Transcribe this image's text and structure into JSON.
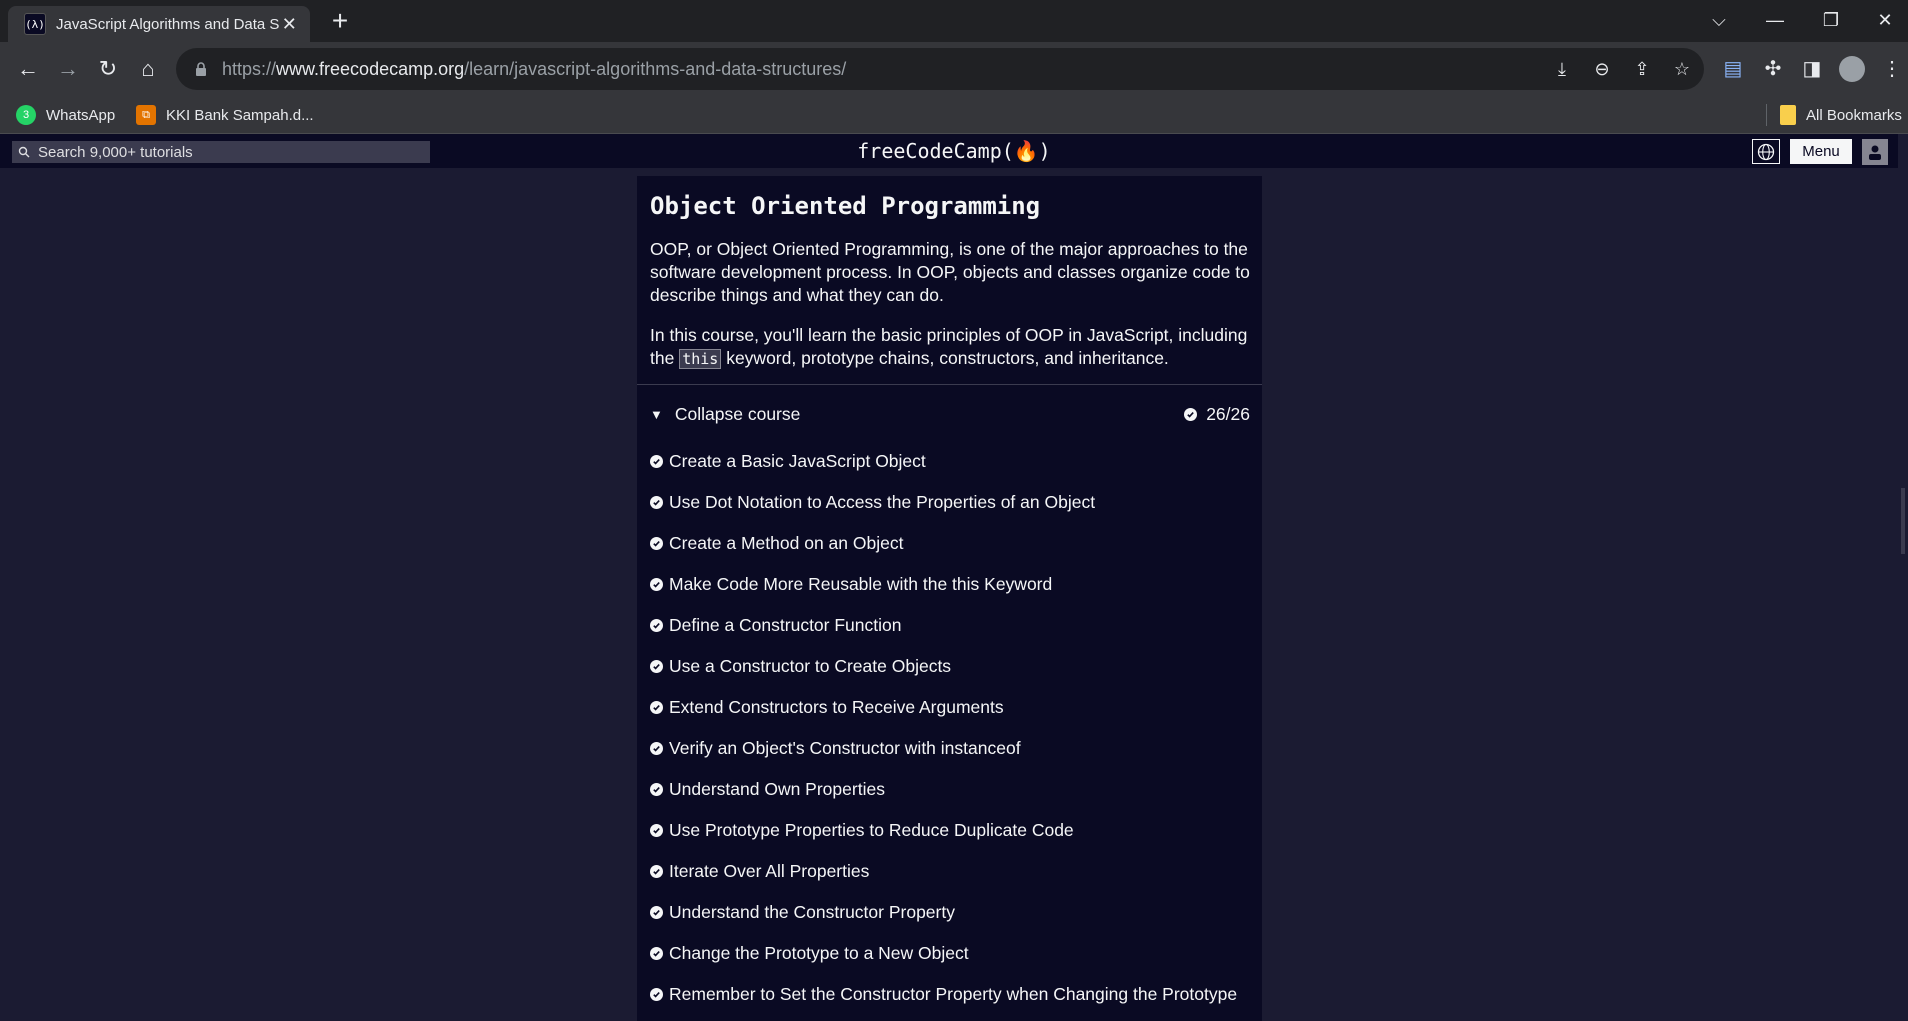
{
  "browser": {
    "tab_title": "JavaScript Algorithms and Data Structures",
    "favicon_text": "(λ)",
    "url_scheme": "https://",
    "url_host": "www.freecodecamp.org",
    "url_path": "/learn/javascript-algorithms-and-data-structures/",
    "bookmarks": [
      {
        "label": "WhatsApp",
        "icon": "whatsapp-icon",
        "badge": "3",
        "color": "#25d366"
      },
      {
        "label": "KKI Bank Sampah.d...",
        "icon": "network-icon",
        "color": "#e37400"
      }
    ],
    "all_bookmarks_label": "All Bookmarks"
  },
  "site": {
    "search_placeholder": "Search 9,000+ tutorials",
    "logo": "freeCodeCamp(🔥)",
    "menu_label": "Menu"
  },
  "course": {
    "title": "Object Oriented Programming",
    "intro": "OOP, or Object Oriented Programming, is one of the major approaches to the software development process. In OOP, objects and classes organize code to describe things and what they can do.",
    "detail_before": "In this course, you'll learn the basic principles of OOP in JavaScript, including the",
    "detail_code": "this",
    "detail_after": "keyword, prototype chains, constructors, and inheritance.",
    "collapse_label": "Collapse course",
    "progress": "26/26",
    "lessons": [
      "Create a Basic JavaScript Object",
      "Use Dot Notation to Access the Properties of an Object",
      "Create a Method on an Object",
      "Make Code More Reusable with the this Keyword",
      "Define a Constructor Function",
      "Use a Constructor to Create Objects",
      "Extend Constructors to Receive Arguments",
      "Verify an Object's Constructor with instanceof",
      "Understand Own Properties",
      "Use Prototype Properties to Reduce Duplicate Code",
      "Iterate Over All Properties",
      "Understand the Constructor Property",
      "Change the Prototype to a New Object",
      "Remember to Set the Constructor Property when Changing the Prototype"
    ]
  }
}
